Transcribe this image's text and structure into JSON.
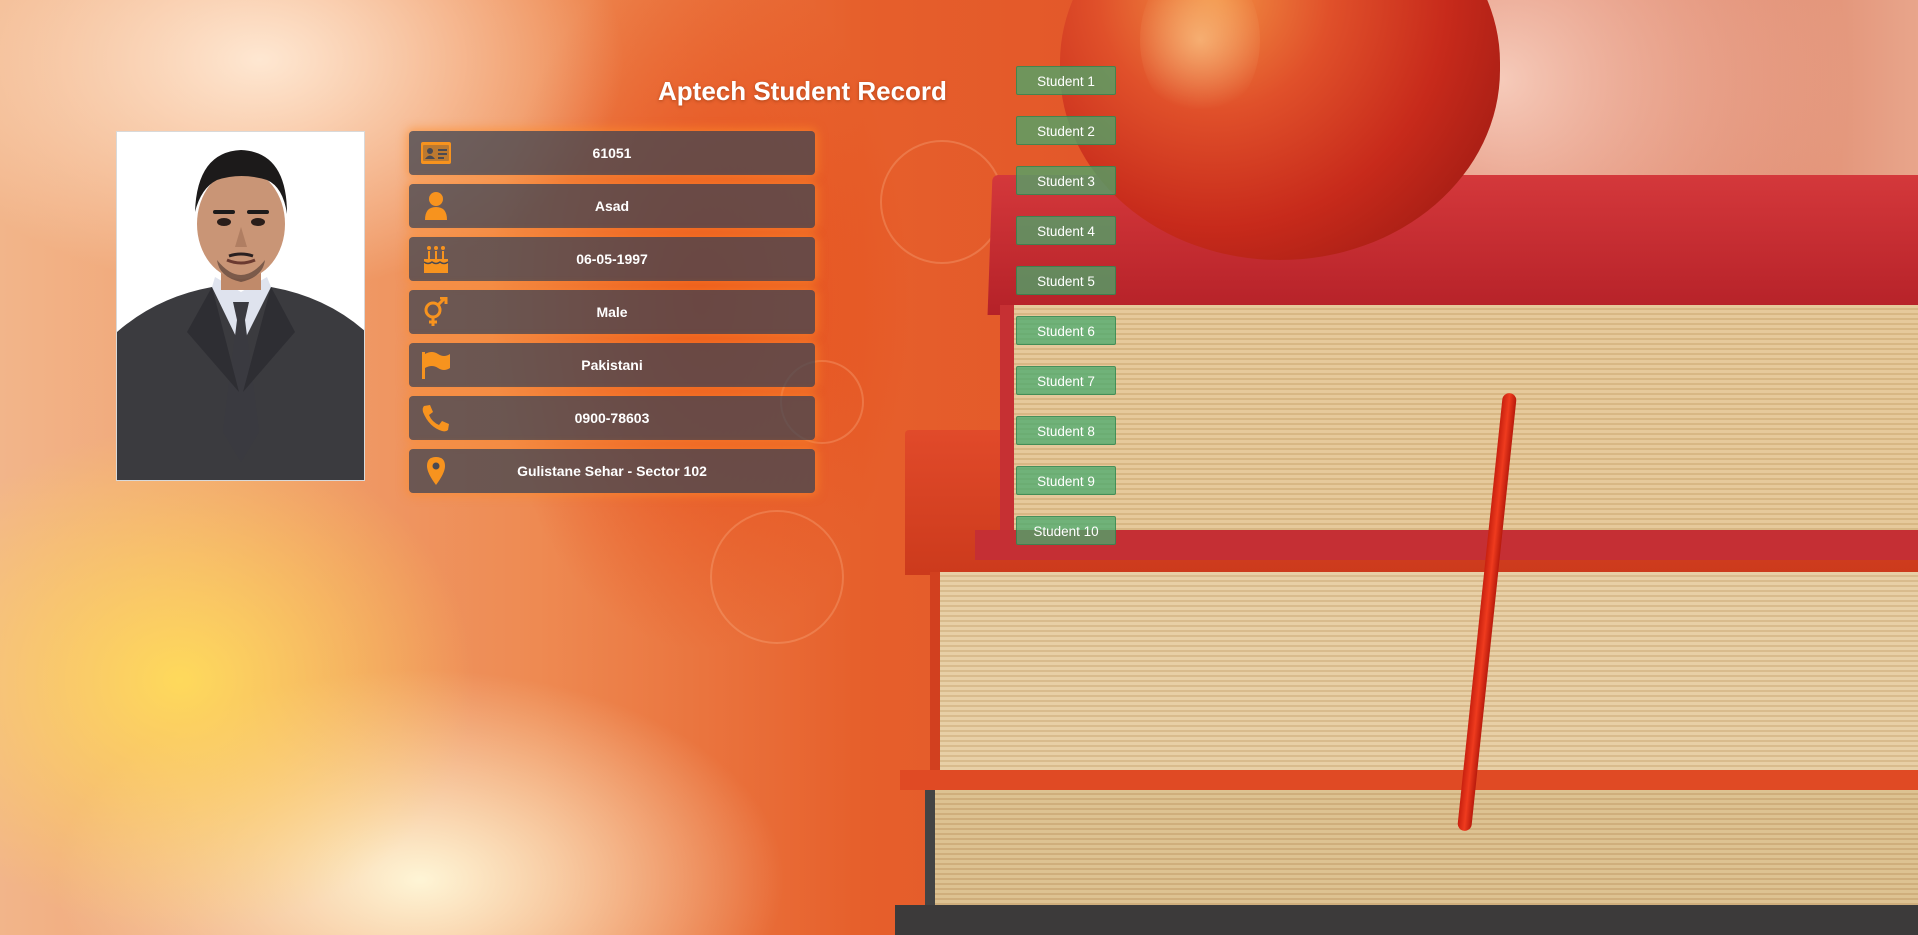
{
  "page": {
    "title": "Aptech Student Record"
  },
  "colors": {
    "accent": "#f7931e",
    "card_bg": "#4a4a52",
    "button_bg": "#4caf70"
  },
  "profile": {
    "photo_alt": "",
    "fields": [
      {
        "icon": "id-card-icon",
        "value": "61051"
      },
      {
        "icon": "user-icon",
        "value": "Asad"
      },
      {
        "icon": "birthday-cake-icon",
        "value": "06-05-1997"
      },
      {
        "icon": "gender-icon",
        "value": "Male"
      },
      {
        "icon": "flag-icon",
        "value": "Pakistani"
      },
      {
        "icon": "phone-icon",
        "value": "0900-78603"
      },
      {
        "icon": "map-marker-icon",
        "value": "Gulistane Sehar - Sector 102"
      }
    ]
  },
  "students": [
    {
      "label": "Student 1"
    },
    {
      "label": "Student 2"
    },
    {
      "label": "Student 3"
    },
    {
      "label": "Student 4"
    },
    {
      "label": "Student 5"
    },
    {
      "label": "Student 6"
    },
    {
      "label": "Student 7"
    },
    {
      "label": "Student 8"
    },
    {
      "label": "Student 9"
    },
    {
      "label": "Student 10"
    }
  ]
}
